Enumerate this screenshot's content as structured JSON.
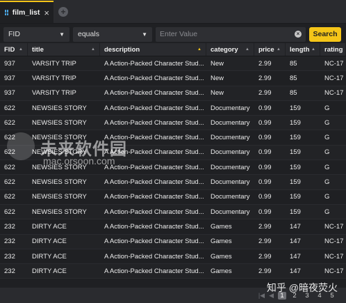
{
  "tab": {
    "label": "film_list",
    "close": "×",
    "add": "+"
  },
  "filter": {
    "field": "FID",
    "operator": "equals",
    "placeholder": "Enter Value",
    "search_label": "Search"
  },
  "columns": [
    "FID",
    "title",
    "description",
    "category",
    "price",
    "length",
    "rating"
  ],
  "rows": [
    [
      "937",
      "VARSITY TRIP",
      "A Action-Packed Character Stud...",
      "New",
      "2.99",
      "85",
      "NC-17"
    ],
    [
      "937",
      "VARSITY TRIP",
      "A Action-Packed Character Stud...",
      "New",
      "2.99",
      "85",
      "NC-17"
    ],
    [
      "937",
      "VARSITY TRIP",
      "A Action-Packed Character Stud...",
      "New",
      "2.99",
      "85",
      "NC-17"
    ],
    [
      "622",
      "NEWSIES STORY",
      "A Action-Packed Character Stud...",
      "Documentary",
      "0.99",
      "159",
      "G"
    ],
    [
      "622",
      "NEWSIES STORY",
      "A Action-Packed Character Stud...",
      "Documentary",
      "0.99",
      "159",
      "G"
    ],
    [
      "622",
      "NEWSIES STORY",
      "A Action-Packed Character Stud...",
      "Documentary",
      "0.99",
      "159",
      "G"
    ],
    [
      "622",
      "NEWSIES STORY",
      "A Action-Packed Character Stud...",
      "Documentary",
      "0.99",
      "159",
      "G"
    ],
    [
      "622",
      "NEWSIES STORY",
      "A Action-Packed Character Stud...",
      "Documentary",
      "0.99",
      "159",
      "G"
    ],
    [
      "622",
      "NEWSIES STORY",
      "A Action-Packed Character Stud...",
      "Documentary",
      "0.99",
      "159",
      "G"
    ],
    [
      "622",
      "NEWSIES STORY",
      "A Action-Packed Character Stud...",
      "Documentary",
      "0.99",
      "159",
      "G"
    ],
    [
      "622",
      "NEWSIES STORY",
      "A Action-Packed Character Stud...",
      "Documentary",
      "0.99",
      "159",
      "G"
    ],
    [
      "232",
      "DIRTY ACE",
      "A Action-Packed Character Stud...",
      "Games",
      "2.99",
      "147",
      "NC-17"
    ],
    [
      "232",
      "DIRTY ACE",
      "A Action-Packed Character Stud...",
      "Games",
      "2.99",
      "147",
      "NC-17"
    ],
    [
      "232",
      "DIRTY ACE",
      "A Action-Packed Character Stud...",
      "Games",
      "2.99",
      "147",
      "NC-17"
    ],
    [
      "232",
      "DIRTY ACE",
      "A Action-Packed Character Stud...",
      "Games",
      "2.99",
      "147",
      "NC-17"
    ]
  ],
  "pagination": {
    "pages": [
      "1",
      "2",
      "3",
      "4",
      "5"
    ],
    "current": "1"
  },
  "watermark": {
    "logo_text": "未来软件园",
    "url": "mac.orsoon.com",
    "source": "知乎 @暗夜荧火"
  },
  "colors": {
    "accent": "#f5c518",
    "background": "#1f2023",
    "header": "#2a2b2f"
  }
}
